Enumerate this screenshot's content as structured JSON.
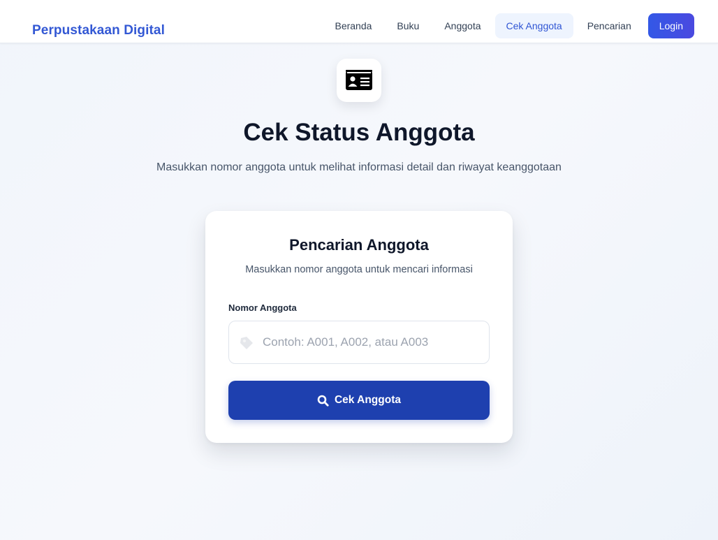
{
  "brand": "Perpustakaan Digital",
  "nav": {
    "items": [
      {
        "label": "Beranda"
      },
      {
        "label": "Buku"
      },
      {
        "label": "Anggota"
      },
      {
        "label": "Cek Anggota",
        "active": true
      },
      {
        "label": "Pencarian"
      }
    ],
    "login_label": "Login"
  },
  "hero": {
    "icon": "id-card-icon",
    "title": "Cek Status Anggota",
    "subtitle": "Masukkan nomor anggota untuk melihat informasi detail dan riwayat keanggotaan"
  },
  "search_card": {
    "title": "Pencarian Anggota",
    "subtitle": "Masukkan nomor anggota untuk mencari informasi",
    "field_label": "Nomor Anggota",
    "field_value": "",
    "field_placeholder": "Contoh: A001, A002, atau A003",
    "field_icon": "tag-icon",
    "button_icon": "search-icon",
    "button_label": "Cek Anggota"
  },
  "colors": {
    "brand": "#3358d4",
    "active_nav_bg": "#eef4fe",
    "login_bg": "#3b54e4",
    "primary_button": "#1e40af"
  }
}
